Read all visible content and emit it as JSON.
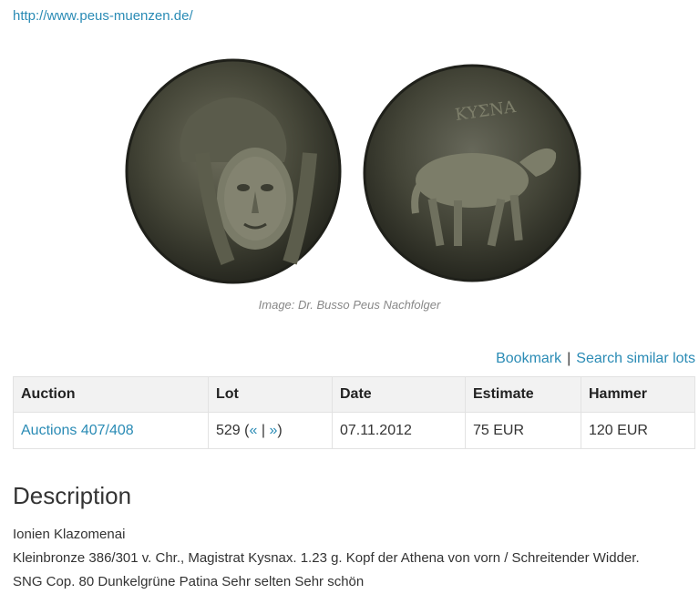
{
  "header": {
    "site_url": "http://www.peus-muenzen.de/"
  },
  "image": {
    "caption": "Image: Dr. Busso Peus Nachfolger",
    "reverse_legend": "ΚΥΣΝΑ"
  },
  "actions": {
    "bookmark": "Bookmark",
    "separator": "|",
    "search_similar": "Search similar lots"
  },
  "table": {
    "headers": {
      "auction": "Auction",
      "lot": "Lot",
      "date": "Date",
      "estimate": "Estimate",
      "hammer": "Hammer"
    },
    "row": {
      "auction": "Auctions 407/408",
      "lot_number": "529",
      "lot_prev": "«",
      "lot_sep": "|",
      "lot_next": "»",
      "date": "07.11.2012",
      "estimate": "75 EUR",
      "hammer": "120 EUR"
    }
  },
  "description": {
    "title": "Description",
    "lines": [
      "Ionien Klazomenai",
      "Kleinbronze 386/301 v. Chr., Magistrat Kysnax. 1.23 g. Kopf der Athena von vorn / Schreitender Widder.",
      "SNG Cop. 80 Dunkelgrüne Patina Sehr selten Sehr schön"
    ]
  }
}
